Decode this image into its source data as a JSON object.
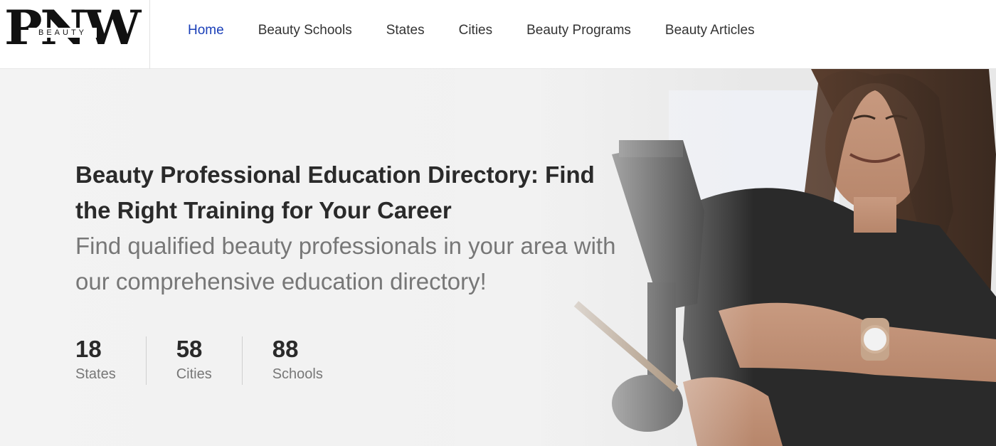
{
  "logo": {
    "letters": "PNW",
    "word": "BEAUTY"
  },
  "nav": {
    "items": [
      {
        "label": "Home",
        "active": true
      },
      {
        "label": "Beauty Schools",
        "active": false
      },
      {
        "label": "States",
        "active": false
      },
      {
        "label": "Cities",
        "active": false
      },
      {
        "label": "Beauty Programs",
        "active": false
      },
      {
        "label": "Beauty Articles",
        "active": false
      }
    ]
  },
  "hero": {
    "title": "Beauty Professional Education Directory: Find the Right Training for Your Career",
    "subtitle": "Find qualified beauty professionals in your area with our comprehensive education directory!"
  },
  "stats": [
    {
      "value": "18",
      "label": "States"
    },
    {
      "value": "58",
      "label": "Cities"
    },
    {
      "value": "88",
      "label": "Schools"
    }
  ],
  "colors": {
    "accent": "#1a3fb8",
    "text": "#2a2a2a",
    "muted": "#777777"
  }
}
